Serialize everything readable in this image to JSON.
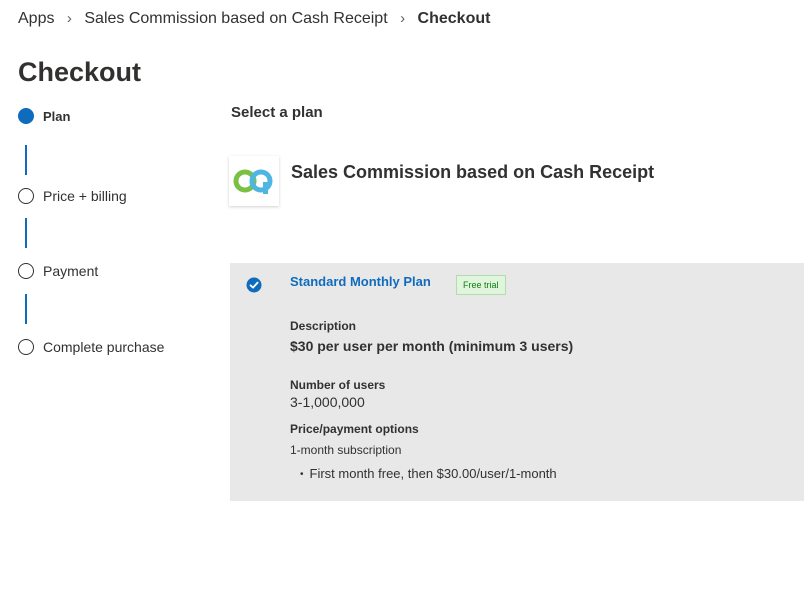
{
  "breadcrumb": {
    "items": [
      "Apps",
      "Sales Commission based on Cash Receipt",
      "Checkout"
    ],
    "separator": "›"
  },
  "page": {
    "title": "Checkout"
  },
  "stepper": {
    "steps": [
      {
        "label": "Plan",
        "active": true
      },
      {
        "label": "Price + billing",
        "active": false
      },
      {
        "label": "Payment",
        "active": false
      },
      {
        "label": "Complete purchase",
        "active": false
      }
    ]
  },
  "main": {
    "section_title": "Select a plan",
    "app_name": "Sales Commission based on Cash Receipt",
    "logo_color": "#4fb6e3",
    "logo_color_secondary": "#7ac143"
  },
  "plan": {
    "name": "Standard Monthly Plan",
    "badge": "Free trial",
    "description_label": "Description",
    "description_value": "$30 per user per month (minimum 3 users)",
    "users_label": "Number of users",
    "users_value": "3-1,000,000",
    "price_label": "Price/payment options",
    "subscription": "1-month subscription",
    "bullet": "First month free, then $30.00/user/1-month"
  },
  "colors": {
    "accent": "#0f6cbd",
    "card_bg": "#e8e8e8",
    "badge_bg": "#dff6dd",
    "badge_text": "#107c10"
  }
}
